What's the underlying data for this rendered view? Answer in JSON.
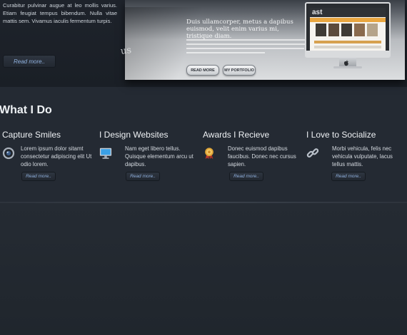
{
  "slider": {
    "text": "Curabitur pulvinar augue at leo mollis varius. Etiam feugiat tempus bibendum. Nulla vitae mattis sem. Vivamus iaculis fermentum turpis.",
    "read_more": "Read more..",
    "slide_heading": "Duis ullamcorper, metus a dapibus euismod, velit enim varius mi, tristique diam.",
    "slide_watermark": "us",
    "buttons": {
      "read_more": "READ MORE",
      "portfolio": "MY PORTFOLIO"
    },
    "monitor_logo": "ast"
  },
  "section": {
    "title": "What I Do"
  },
  "services": [
    {
      "title": "Capture Smiles",
      "text": "Lorem ipsum dolor sitamt consectetur adipiscing elit Ut odio lorem.",
      "read_more": "Read more..",
      "icon": "camera-lens-icon"
    },
    {
      "title": "I Design Websites",
      "text": "Nam eget libero tellus. Quisque elementum arcu ut dapibus.",
      "read_more": "Read more..",
      "icon": "monitor-icon"
    },
    {
      "title": "Awards I Recieve",
      "text": "Donec euismod dapibus faucibus. Donec nec cursus sapien.",
      "read_more": "Read more..",
      "icon": "award-medal-icon"
    },
    {
      "title": "I Love to Socialize",
      "text": "Morbi vehicula, felis nec vehicula vulputate, lacus tellus mattis.",
      "read_more": "Read more..",
      "icon": "chain-link-icon"
    }
  ],
  "colors": {
    "background": "#242a33",
    "link": "#8fb0dd",
    "award": "#e0a637"
  }
}
